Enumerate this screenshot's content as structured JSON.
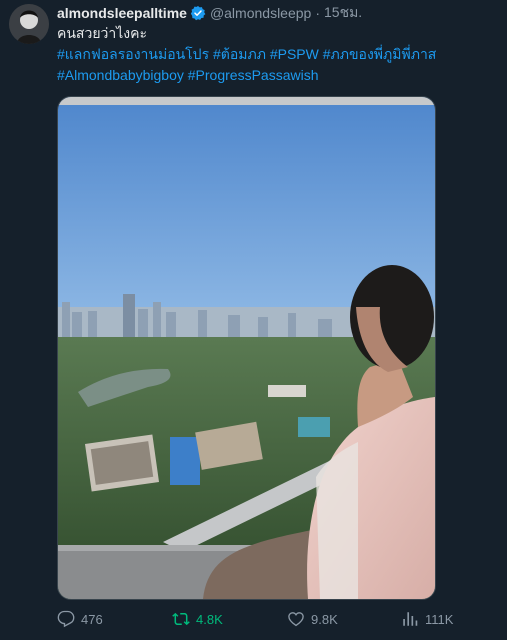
{
  "tweet": {
    "display_name": "almondsleepalltime",
    "handle": "@almondsleepp",
    "separator": "·",
    "time": "15ชม.",
    "text": "คนสวยว่าไงคะ",
    "hashtags_line1": "#แลกฟอลรองานม่อนโปร #ต้อมภภ #PSPW #ภภของพี่ภูมิพี่ภาส",
    "hashtags_line2": "#Almondbabybigboy #ProgressPassawish"
  },
  "actions": {
    "replies": "476",
    "retweets": "4.8K",
    "likes": "9.8K",
    "views": "111K"
  },
  "colors": {
    "background": "#15202b",
    "link": "#1d9bf0",
    "muted": "#8b98a5",
    "retweet_active": "#00ba7c",
    "verified": "#1d9bf0"
  },
  "icons": {
    "verified": "verified-badge-icon",
    "reply": "speech-bubble-icon",
    "retweet": "retweet-arrows-icon",
    "like": "heart-icon",
    "views": "bar-chart-icon"
  }
}
